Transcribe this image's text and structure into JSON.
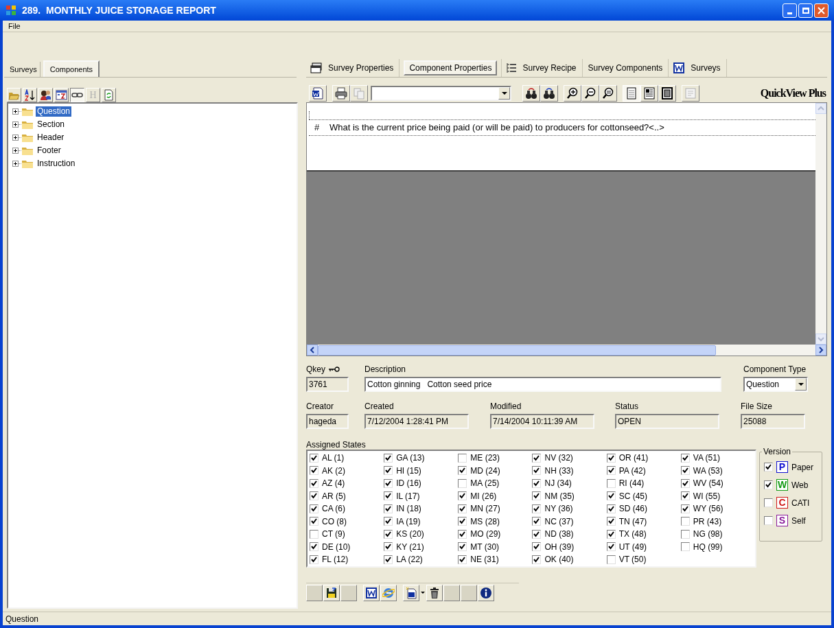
{
  "window": {
    "title": "289.  MONTHLY JUICE STORAGE REPORT"
  },
  "menu": [
    "File"
  ],
  "left_tabs": [
    {
      "label": "Surveys",
      "selected": false
    },
    {
      "label": "Components",
      "selected": true
    }
  ],
  "left_toolbar": {
    "h_label": "H",
    "h_disabled": true
  },
  "tree": [
    {
      "label": "Question",
      "selected": true,
      "expanded": false
    },
    {
      "label": "Section",
      "selected": false,
      "expanded": false
    },
    {
      "label": "Header",
      "selected": false,
      "expanded": false
    },
    {
      "label": "Footer",
      "selected": false,
      "expanded": false
    },
    {
      "label": "Instruction",
      "selected": false,
      "expanded": false
    }
  ],
  "right_tabs": [
    {
      "label": "Survey Properties",
      "selected": false
    },
    {
      "label": "Component Properties",
      "selected": true
    },
    {
      "label": "Survey Recipe",
      "selected": false
    },
    {
      "label": "Survey Components",
      "selected": false
    },
    {
      "label": "Surveys",
      "selected": false
    }
  ],
  "viewer": {
    "brand": "QuickView Plus",
    "line_marker": "#",
    "line_text": "What is the current price being paid (or will be paid) to producers for cottonseed?<..>"
  },
  "fields": {
    "qkey": {
      "label": "Qkey",
      "value": "3761"
    },
    "description": {
      "label": "Description",
      "value": "Cotton ginning   Cotton seed price"
    },
    "component_type": {
      "label": "Component Type",
      "value": "Question"
    },
    "creator": {
      "label": "Creator",
      "value": "hageda"
    },
    "created": {
      "label": "Created",
      "value": "7/12/2004 1:28:41 PM"
    },
    "modified": {
      "label": "Modified",
      "value": "7/14/2004 10:11:39 AM"
    },
    "status": {
      "label": "Status",
      "value": "OPEN"
    },
    "file_size": {
      "label": "File Size",
      "value": "25088"
    }
  },
  "assigned_states": {
    "label": "Assigned States",
    "states": [
      {
        "label": "AL (1)",
        "checked": true
      },
      {
        "label": "AK (2)",
        "checked": true
      },
      {
        "label": "AZ (4)",
        "checked": true
      },
      {
        "label": "AR (5)",
        "checked": true
      },
      {
        "label": "CA (6)",
        "checked": true
      },
      {
        "label": "CO (8)",
        "checked": true
      },
      {
        "label": "CT (9)",
        "checked": false
      },
      {
        "label": "DE (10)",
        "checked": true
      },
      {
        "label": "FL (12)",
        "checked": true
      },
      {
        "label": "GA (13)",
        "checked": true
      },
      {
        "label": "HI (15)",
        "checked": true
      },
      {
        "label": "ID (16)",
        "checked": true
      },
      {
        "label": "IL (17)",
        "checked": true
      },
      {
        "label": "IN (18)",
        "checked": true
      },
      {
        "label": "IA (19)",
        "checked": true
      },
      {
        "label": "KS (20)",
        "checked": true
      },
      {
        "label": "KY (21)",
        "checked": true
      },
      {
        "label": "LA (22)",
        "checked": true
      },
      {
        "label": "ME (23)",
        "checked": false
      },
      {
        "label": "MD (24)",
        "checked": true
      },
      {
        "label": "MA (25)",
        "checked": false
      },
      {
        "label": "MI (26)",
        "checked": true
      },
      {
        "label": "MN (27)",
        "checked": true
      },
      {
        "label": "MS (28)",
        "checked": true
      },
      {
        "label": "MO (29)",
        "checked": true
      },
      {
        "label": "MT (30)",
        "checked": true
      },
      {
        "label": "NE (31)",
        "checked": true
      },
      {
        "label": "NV (32)",
        "checked": true
      },
      {
        "label": "NH (33)",
        "checked": true
      },
      {
        "label": "NJ (34)",
        "checked": true
      },
      {
        "label": "NM (35)",
        "checked": true
      },
      {
        "label": "NY (36)",
        "checked": true
      },
      {
        "label": "NC (37)",
        "checked": true
      },
      {
        "label": "ND (38)",
        "checked": true
      },
      {
        "label": "OH (39)",
        "checked": true
      },
      {
        "label": "OK (40)",
        "checked": true
      },
      {
        "label": "OR (41)",
        "checked": true
      },
      {
        "label": "PA (42)",
        "checked": true
      },
      {
        "label": "RI (44)",
        "checked": false
      },
      {
        "label": "SC (45)",
        "checked": true
      },
      {
        "label": "SD (46)",
        "checked": true
      },
      {
        "label": "TN (47)",
        "checked": true
      },
      {
        "label": "TX (48)",
        "checked": true
      },
      {
        "label": "UT (49)",
        "checked": true
      },
      {
        "label": "VT (50)",
        "checked": false
      },
      {
        "label": "VA (51)",
        "checked": true
      },
      {
        "label": "WA (53)",
        "checked": true
      },
      {
        "label": "WV (54)",
        "checked": true
      },
      {
        "label": "WI (55)",
        "checked": true
      },
      {
        "label": "WY (56)",
        "checked": true
      },
      {
        "label": "PR (43)",
        "checked": false
      },
      {
        "label": "NG (98)",
        "checked": false
      },
      {
        "label": "HQ (99)",
        "checked": false
      }
    ]
  },
  "version": {
    "label": "Version",
    "items": [
      {
        "badge": "P",
        "label": "Paper",
        "color": "#1010d0",
        "checked": true
      },
      {
        "badge": "W",
        "label": "Web",
        "color": "#119911",
        "checked": true
      },
      {
        "badge": "C",
        "label": "CATI",
        "color": "#d01818",
        "checked": false
      },
      {
        "badge": "S",
        "label": "Self",
        "color": "#8a1a9a",
        "checked": false
      }
    ]
  },
  "status_bar": "Question"
}
